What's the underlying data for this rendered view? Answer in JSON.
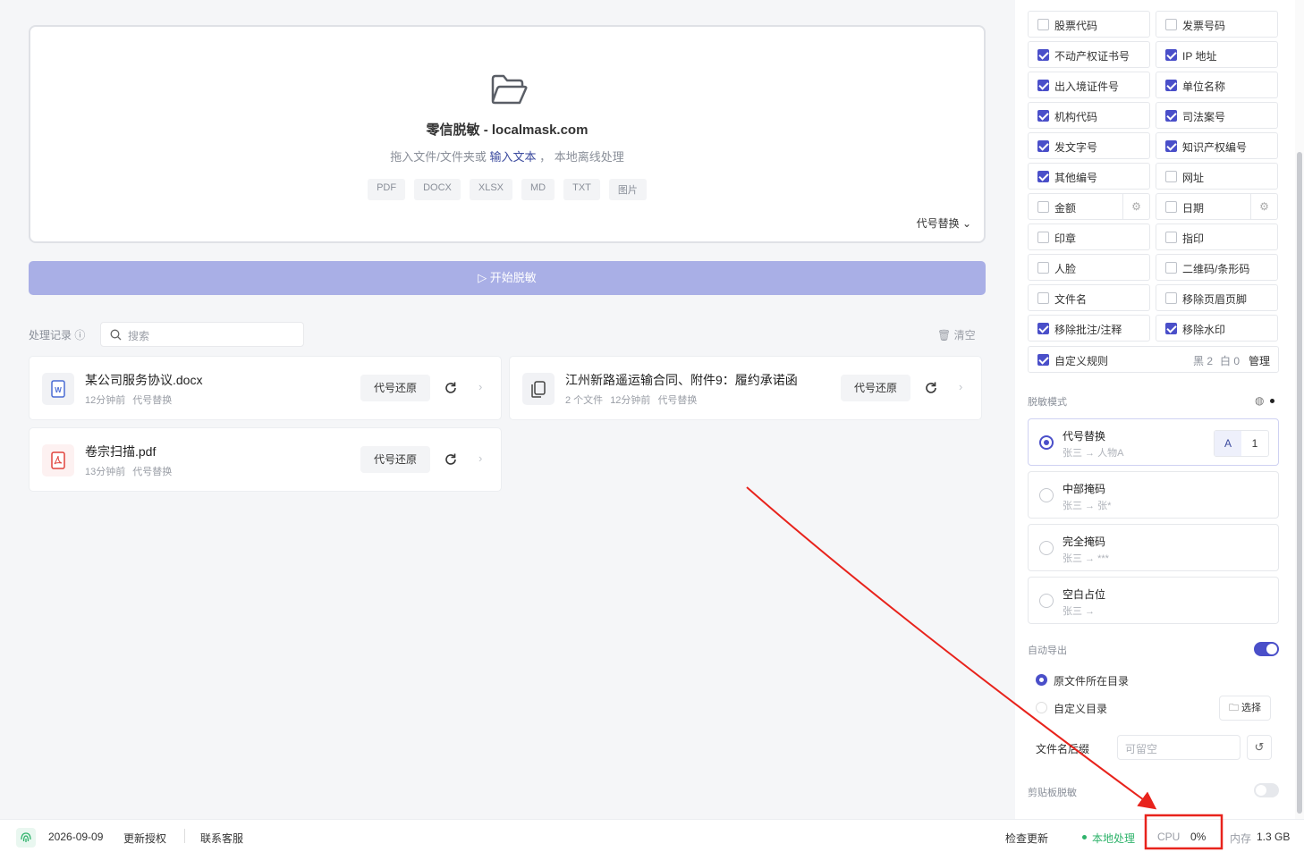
{
  "dropzone": {
    "title": "零信脱敏 - localmask.com",
    "subtitle_prefix": "拖入文件/文件夹或",
    "subtitle_link": "输入文本",
    "subtitle_suffix": "， 本地离线处理",
    "formats": [
      "PDF",
      "DOCX",
      "XLSX",
      "MD",
      "TXT",
      "图片"
    ],
    "mode_selector": "代号替换 ⌄"
  },
  "start_button": "▷ 开始脱敏",
  "history": {
    "label": "处理记录 ⓘ",
    "search_placeholder": "搜索",
    "clear_label": "清空",
    "restore_label": "代号还原",
    "items": [
      {
        "name": "某公司服务协议.docx",
        "time": "12分钟前",
        "mode": "代号替换",
        "count": ""
      },
      {
        "name": "江州新路遥运输合同、附件9：履约承诺函",
        "time": "12分钟前",
        "mode": "代号替换",
        "count": "2 个文件"
      },
      {
        "name": "卷宗扫描.pdf",
        "time": "13分钟前",
        "mode": "代号替换",
        "count": ""
      }
    ]
  },
  "rules": [
    {
      "label": "股票代码",
      "checked": false
    },
    {
      "label": "发票号码",
      "checked": false
    },
    {
      "label": "不动产权证书号",
      "checked": true
    },
    {
      "label": "IP 地址",
      "checked": true
    },
    {
      "label": "出入境证件号",
      "checked": true
    },
    {
      "label": "单位名称",
      "checked": true
    },
    {
      "label": "机构代码",
      "checked": true
    },
    {
      "label": "司法案号",
      "checked": true
    },
    {
      "label": "发文字号",
      "checked": true
    },
    {
      "label": "知识产权编号",
      "checked": true
    },
    {
      "label": "其他编号",
      "checked": true
    },
    {
      "label": "网址",
      "checked": false
    },
    {
      "label": "金额",
      "checked": false
    },
    {
      "label": "日期",
      "checked": false
    },
    {
      "label": "印章",
      "checked": false
    },
    {
      "label": "指印",
      "checked": false
    },
    {
      "label": "人脸",
      "checked": false
    },
    {
      "label": "二维码/条形码",
      "checked": false
    },
    {
      "label": "文件名",
      "checked": false
    },
    {
      "label": "移除页眉页脚",
      "checked": false
    },
    {
      "label": "移除批注/注释",
      "checked": true
    },
    {
      "label": "移除水印",
      "checked": true
    }
  ],
  "custom_rules": {
    "label": "自定义规则",
    "checked": true,
    "black": "黑 2",
    "white": "白 0",
    "manage": "管理"
  },
  "mask_mode": {
    "label": "脱敏模式",
    "options": [
      {
        "name": "代号替换",
        "example_from": "张三",
        "example_to": "人物A",
        "selected": true
      },
      {
        "name": "中部掩码",
        "example_from": "张三",
        "example_to": "张*",
        "selected": false
      },
      {
        "name": "完全掩码",
        "example_from": "张三",
        "example_to": "***",
        "selected": false
      },
      {
        "name": "空白占位",
        "example_from": "张三",
        "example_to": "",
        "selected": false
      }
    ],
    "style_a": "A",
    "style_1": "1"
  },
  "auto_export": {
    "label": "自动导出",
    "enabled": true,
    "opt_source": "原文件所在目录",
    "opt_custom": "自定义目录",
    "pick_label": "选择",
    "suffix_label": "文件名后缀",
    "suffix_placeholder": "可留空"
  },
  "clipboard": {
    "label": "剪贴板脱敏",
    "enabled": false
  },
  "status": {
    "date": "2026-09-09",
    "renew": "更新授权",
    "contact": "联系客服",
    "check_update": "检查更新",
    "local": "本地处理",
    "cpu_label": "CPU",
    "cpu_value": "0%",
    "mem_label": "内存",
    "mem_value": "1.3 GB"
  },
  "colors": {
    "accent": "#4a4fc9",
    "annotation": "#e8231c",
    "local_status": "#2fb36b"
  }
}
